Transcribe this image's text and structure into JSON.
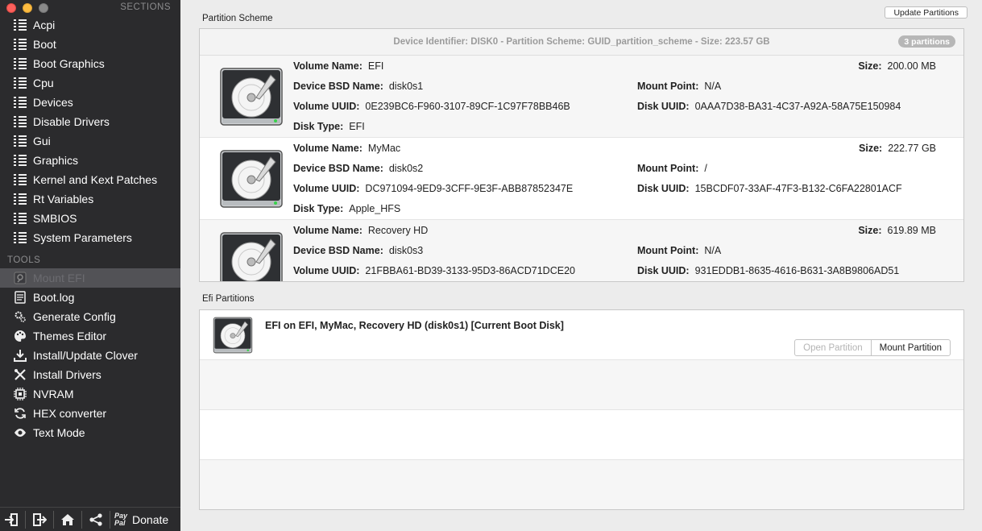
{
  "sidebar": {
    "sections_title": "SECTIONS",
    "sections": [
      {
        "label": "Acpi"
      },
      {
        "label": "Boot"
      },
      {
        "label": "Boot Graphics"
      },
      {
        "label": "Cpu"
      },
      {
        "label": "Devices"
      },
      {
        "label": "Disable Drivers"
      },
      {
        "label": "Gui"
      },
      {
        "label": "Graphics"
      },
      {
        "label": "Kernel and Kext Patches"
      },
      {
        "label": "Rt Variables"
      },
      {
        "label": "SMBIOS"
      },
      {
        "label": "System Parameters"
      }
    ],
    "tools_title": "TOOLS",
    "tools": [
      {
        "label": "Mount EFI",
        "icon": "mount-efi-icon",
        "selected": true
      },
      {
        "label": "Boot.log",
        "icon": "log-icon"
      },
      {
        "label": "Generate Config",
        "icon": "gears-icon"
      },
      {
        "label": "Themes Editor",
        "icon": "palette-icon"
      },
      {
        "label": "Install/Update Clover",
        "icon": "download-icon"
      },
      {
        "label": "Install Drivers",
        "icon": "tools-icon"
      },
      {
        "label": "NVRAM",
        "icon": "chip-icon"
      },
      {
        "label": "HEX converter",
        "icon": "refresh-icon"
      },
      {
        "label": "Text Mode",
        "icon": "eye-icon"
      }
    ],
    "bottom": {
      "paypal_top": "Pay",
      "paypal_bottom": "Pal",
      "donate_label": "Donate"
    }
  },
  "main": {
    "scheme_label": "Partition Scheme",
    "update_button": "Update Partitions",
    "scheme_header": "Device Identifier: DISK0 - Partition Scheme: GUID_partition_scheme - Size: 223.57 GB",
    "partition_count": "3 partitions",
    "field_labels": {
      "volume_name": "Volume Name:",
      "bsd_name": "Device BSD Name:",
      "volume_uuid": "Volume UUID:",
      "disk_type": "Disk Type:",
      "size": "Size:",
      "mount_point": "Mount Point:",
      "disk_uuid": "Disk UUID:"
    },
    "volumes": [
      {
        "volume_name": "EFI",
        "bsd_name": "disk0s1",
        "volume_uuid": "0E239BC6-F960-3107-89CF-1C97F78BB46B",
        "disk_type": "EFI",
        "size": "200.00 MB",
        "mount_point": "N/A",
        "disk_uuid": "0AAA7D38-BA31-4C37-A92A-58A75E150984"
      },
      {
        "volume_name": "MyMac",
        "bsd_name": "disk0s2",
        "volume_uuid": "DC971094-9ED9-3CFF-9E3F-ABB87852347E",
        "disk_type": "Apple_HFS",
        "size": "222.77 GB",
        "mount_point": "/",
        "disk_uuid": "15BCDF07-33AF-47F3-B132-C6FA22801ACF"
      },
      {
        "volume_name": "Recovery HD",
        "bsd_name": "disk0s3",
        "volume_uuid": "21FBBA61-BD39-3133-95D3-86ACD71DCE20",
        "disk_type": "",
        "size": "619.89 MB",
        "mount_point": "N/A",
        "disk_uuid": "931EDDB1-8635-4616-B631-3A8B9806AD51"
      }
    ],
    "efi_label": "Efi Partitions",
    "efi_entry": "EFI on EFI, MyMac, Recovery HD (disk0s1) [Current Boot Disk]",
    "open_partition": "Open Partition",
    "mount_partition": "Mount Partition"
  }
}
